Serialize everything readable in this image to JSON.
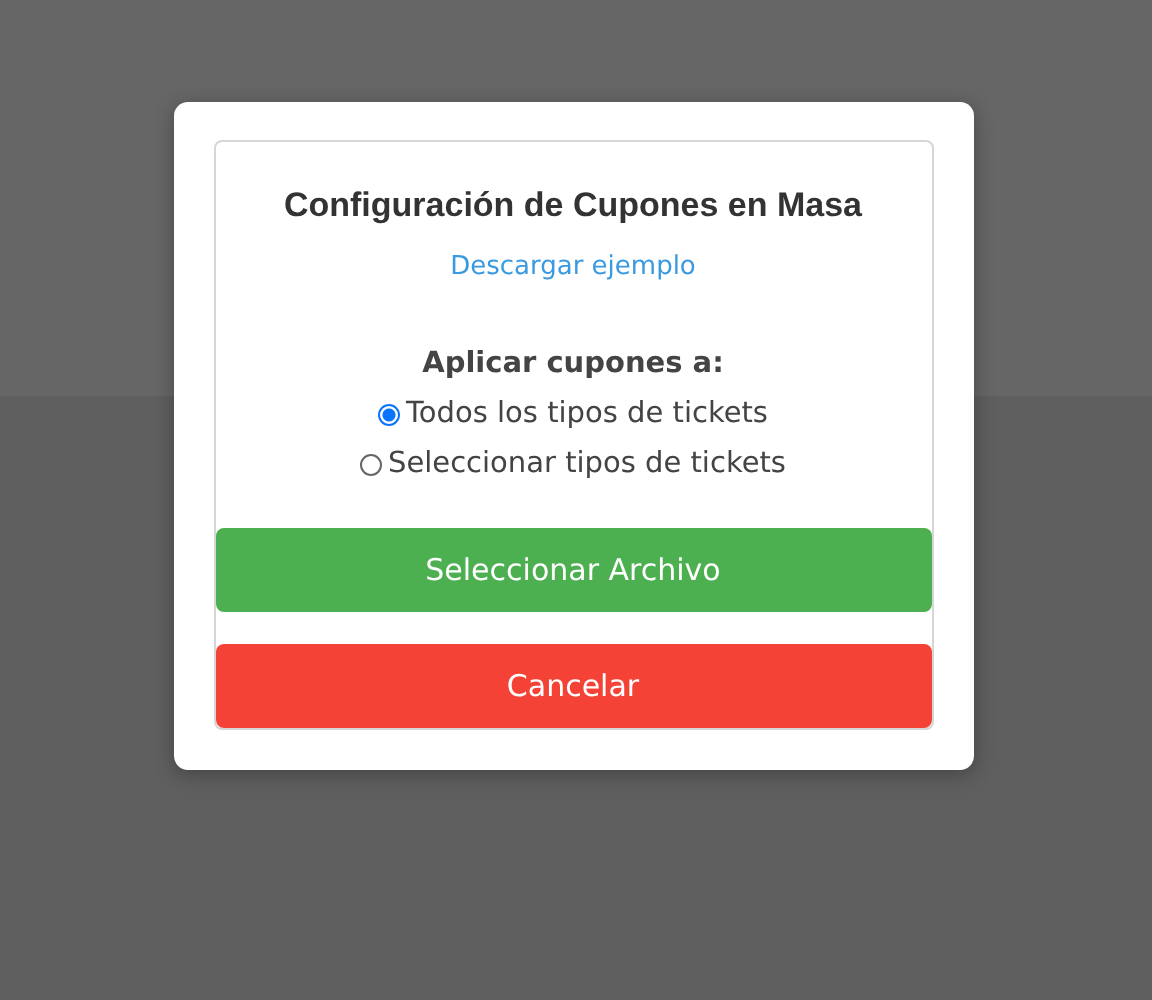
{
  "dialog": {
    "title": "Configuración de Cupones en Masa",
    "link": "Descargar ejemplo",
    "section_label": "Aplicar cupones a:",
    "options": [
      {
        "label": "Todos los tipos de tickets",
        "selected": true
      },
      {
        "label": "Seleccionar tipos de tickets",
        "selected": false
      }
    ],
    "buttons": [
      {
        "label": "Seleccionar Archivo",
        "kind": "primary"
      },
      {
        "label": "Cancelar",
        "kind": "cancel"
      }
    ]
  }
}
